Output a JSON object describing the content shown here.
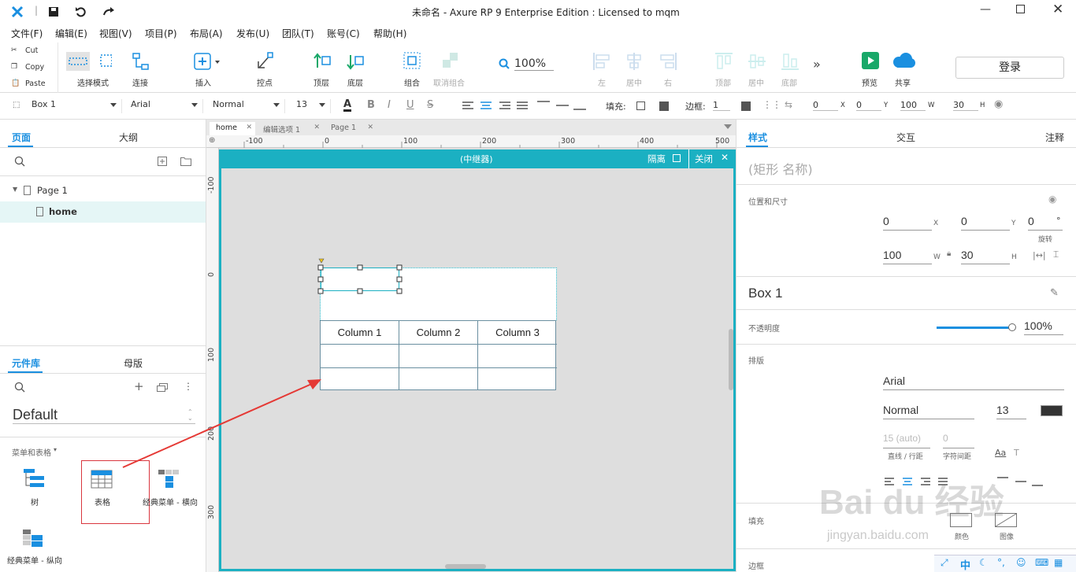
{
  "title": "未命名 - Axure RP 9 Enterprise Edition : Licensed to mqm",
  "menu": [
    "文件(F)",
    "编辑(E)",
    "视图(V)",
    "项目(P)",
    "布局(A)",
    "发布(U)",
    "团队(T)",
    "账号(C)",
    "帮助(H)"
  ],
  "clipboard": {
    "cut": "Cut",
    "copy": "Copy",
    "paste": "Paste"
  },
  "toolbar": {
    "select_mode": "选择模式",
    "connect": "连接",
    "insert": "插入",
    "point": "控点",
    "top": "顶层",
    "bottom": "底层",
    "group": "组合",
    "ungroup": "取消组合",
    "zoom": "100%",
    "left": "左",
    "center": "居中",
    "right": "右",
    "vtop": "顶部",
    "vmid": "居中",
    "vbottom": "底部",
    "preview": "预览",
    "share": "共享",
    "login": "登录"
  },
  "format": {
    "widget": "Box 1",
    "font": "Arial",
    "style": "Normal",
    "size": "13",
    "fill_label": "填充:",
    "border_label": "边框:",
    "border_val": "1",
    "x": "0",
    "x_l": "X",
    "y": "0",
    "y_l": "Y",
    "w": "100",
    "w_l": "W",
    "h": "30",
    "h_l": "H"
  },
  "left": {
    "tab_pages": "页面",
    "tab_outline": "大纲",
    "page_parent": "Page 1",
    "page_child": "home",
    "tab_library": "元件库",
    "tab_masters": "母版",
    "library": "Default",
    "group_title": "菜单和表格",
    "widgets": [
      "树",
      "表格",
      "经典菜单 - 横向",
      "经典菜单 - 纵向"
    ]
  },
  "doc_tabs": [
    "home",
    "编辑选项 1",
    "Page 1"
  ],
  "ruler_h": [
    "-100",
    "0",
    "100",
    "200",
    "300",
    "400",
    "500"
  ],
  "ruler_v": [
    "-100",
    "0",
    "100",
    "200",
    "300"
  ],
  "repeater": {
    "title": "(中继器)",
    "isolate": "隔离",
    "close": "关闭"
  },
  "table": {
    "headers": [
      "Column 1",
      "Column 2",
      "Column 3"
    ]
  },
  "right": {
    "tab_style": "样式",
    "tab_interact": "交互",
    "tab_notes": "注释",
    "shape_name": "(矩形 名称)",
    "pos_size": "位置和尺寸",
    "x": "0",
    "y": "0",
    "rot": "0",
    "rot_unit": "°",
    "rot_label": "旋转",
    "w": "100",
    "h": "30",
    "lbl_x": "X",
    "lbl_y": "Y",
    "lbl_w": "W",
    "lbl_h": "H",
    "style_name": "Box 1",
    "opacity_label": "不透明度",
    "opacity": "100%",
    "typo_label": "排版",
    "font": "Arial",
    "weight": "Normal",
    "size": "13",
    "line_h": "15 (auto)",
    "letter": "0",
    "line_h_label": "直线 / 行距",
    "letter_label": "字符间距",
    "fill_label": "填充",
    "border_label": "边框",
    "fill_color": "颜色",
    "fill_image": "图像",
    "aa": "Aa"
  },
  "colors": {
    "accent": "#1bb0c2",
    "blue": "#1a8fe0",
    "arrow": "#e53935",
    "callout": "#d9363e"
  },
  "watermark": {
    "logo": "Bai du 经验",
    "url": "jingyan.baidu.com"
  },
  "status": {
    "lang": "中"
  }
}
